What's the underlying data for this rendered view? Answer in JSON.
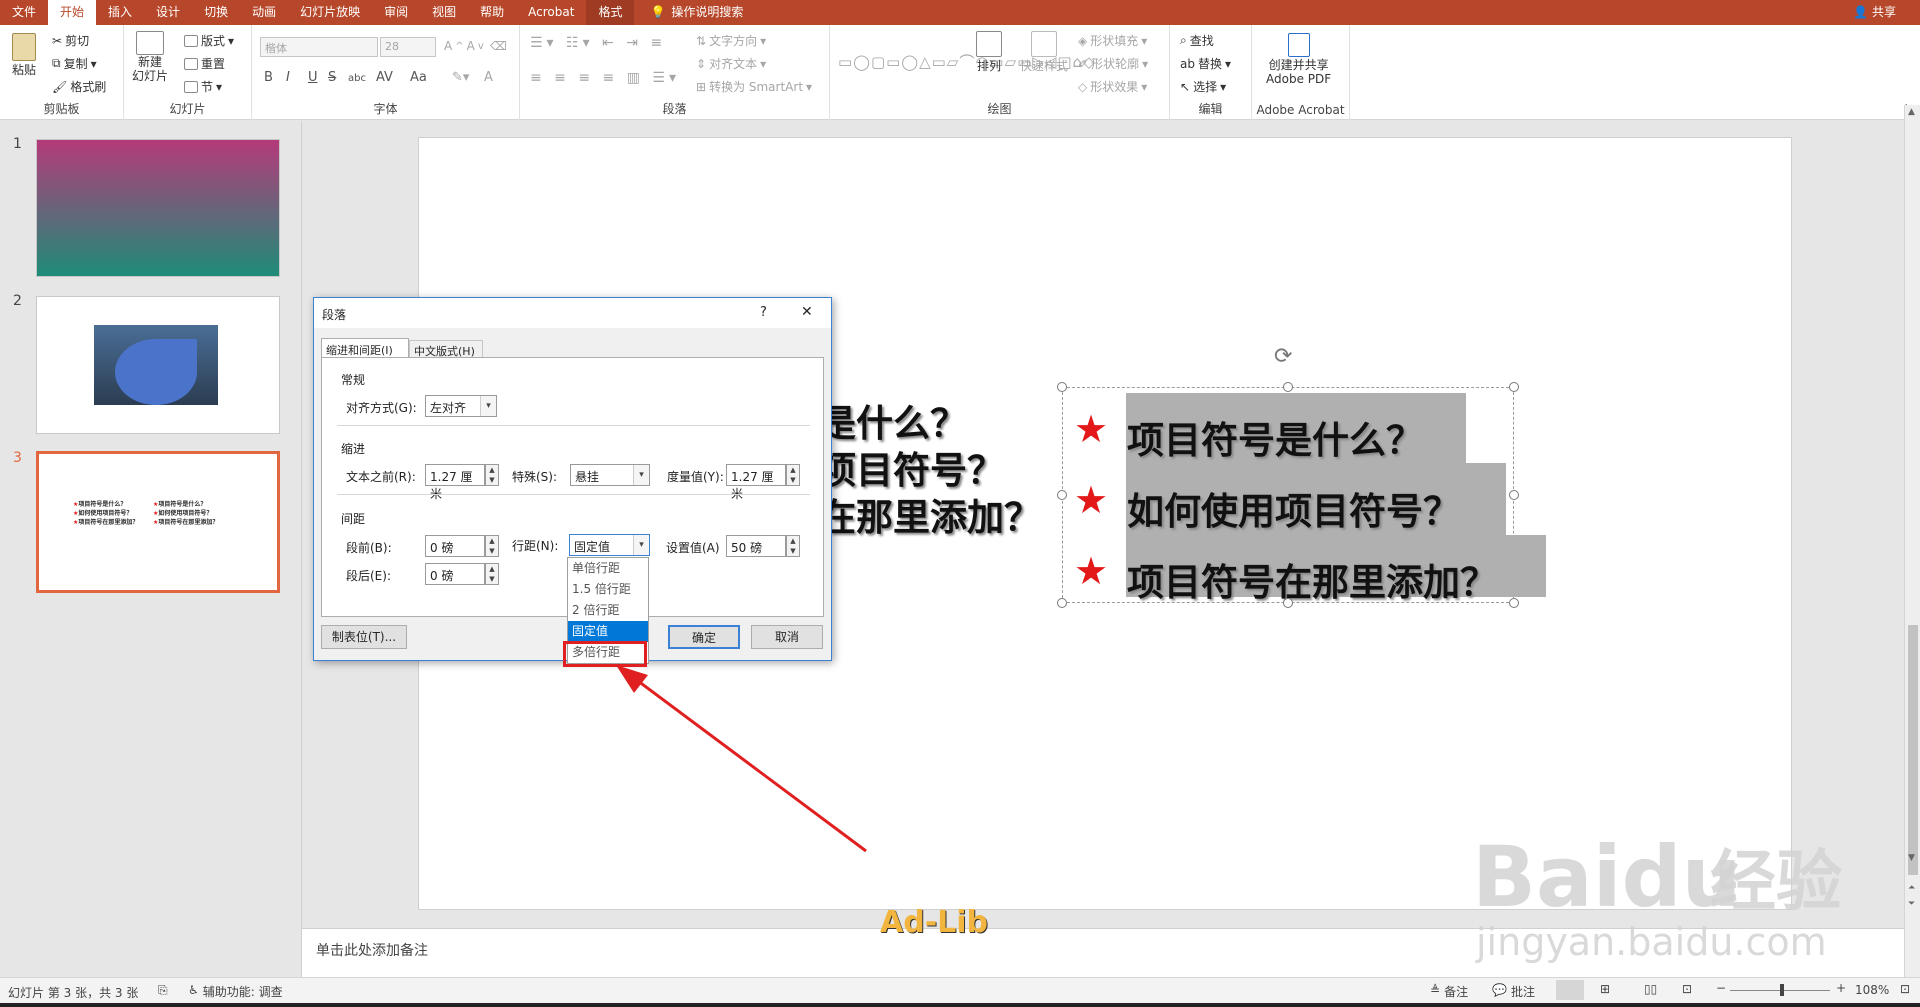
{
  "tabs": [
    "文件",
    "开始",
    "插入",
    "设计",
    "切换",
    "动画",
    "幻灯片放映",
    "审阅",
    "视图",
    "帮助",
    "Acrobat",
    "格式",
    "操作说明搜索"
  ],
  "share": "共享",
  "ribbon": {
    "clipboard": {
      "paste": "粘贴",
      "cut": "剪切",
      "copy": "复制",
      "format_painter": "格式刷",
      "label": "剪贴板"
    },
    "slides": {
      "new_slide": "新建\n幻灯片",
      "layout": "版式",
      "reset": "重置",
      "section": "节",
      "label": "幻灯片"
    },
    "font": {
      "font_name": "楷体",
      "font_size": "28",
      "label": "字体",
      "format_buttons": [
        "B",
        "I",
        "U",
        "S",
        "abc",
        "AV",
        "Aa",
        "A"
      ]
    },
    "paragraph": {
      "text_direction": "文字方向",
      "align_text": "对齐文本",
      "smartart": "转换为 SmartArt",
      "label": "段落"
    },
    "drawing": {
      "arrange": "排列",
      "quick_styles": "快速样式",
      "shape_fill": "形状填充",
      "shape_outline": "形状轮廓",
      "shape_effects": "形状效果",
      "label": "绘图"
    },
    "editing": {
      "find": "查找",
      "replace": "替换",
      "select": "选择",
      "label": "编辑"
    },
    "acrobat": {
      "create_share": "创建并共享\nAdobe PDF",
      "label": "Adobe Acrobat"
    }
  },
  "slides": [
    {
      "num": "1"
    },
    {
      "num": "2"
    },
    {
      "num": "3"
    }
  ],
  "thumb3_lines": [
    "项目符号是什么？",
    "如何使用项目符号？",
    "项目符号在那里添加？",
    "项目符号是什么？",
    "如何使用项目符号？",
    "项目符号在那里添加？"
  ],
  "slide": {
    "left_lines": [
      "是什么？",
      "项目符号？",
      "在那里添加？"
    ],
    "bullet_lines": [
      "项目符号是什么？",
      "如何使用项目符号？",
      "项目符号在那里添加？"
    ],
    "star": "★"
  },
  "notes_placeholder": "单击此处添加备注",
  "status": {
    "slide_info": "幻灯片 第 3 张，共 3 张",
    "accessibility": "辅助功能: 调查",
    "notes": "备注",
    "comments": "批注",
    "zoom": "108%"
  },
  "dialog": {
    "title": "段落",
    "help": "?",
    "close": "✕",
    "tab_indent": "缩进和间距(I)",
    "tab_chinese": "中文版式(H)",
    "general": "常规",
    "alignment_label": "对齐方式(G):",
    "alignment_value": "左对齐",
    "indent": "缩进",
    "before_text_label": "文本之前(R):",
    "before_text_value": "1.27 厘米",
    "special_label": "特殊(S):",
    "special_value": "悬挂",
    "by_label": "度量值(Y):",
    "by_value": "1.27 厘米",
    "spacing": "间距",
    "before_label": "段前(B):",
    "before_value": "0 磅",
    "after_label": "段后(E):",
    "after_value": "0 磅",
    "line_spacing_label": "行距(N):",
    "line_spacing_value": "固定值",
    "at_label": "设置值(A)",
    "at_value": "50 磅",
    "tabs_button": "制表位(T)...",
    "ok": "确定",
    "cancel": "取消",
    "line_spacing_options": [
      "单倍行距",
      "1.5 倍行距",
      "2 倍行距",
      "固定值",
      "多倍行距"
    ],
    "selected_option": 3
  },
  "watermark": {
    "adlib": "Ad-Lib",
    "baidu": "Baidu",
    "jingyan_cn": "经验",
    "jingyan_url": "jingyan.baidu.com"
  },
  "colors": {
    "accent": "#b7472a",
    "star": "#e31919",
    "selection": "#0078d7",
    "annotation": "#e02020"
  }
}
